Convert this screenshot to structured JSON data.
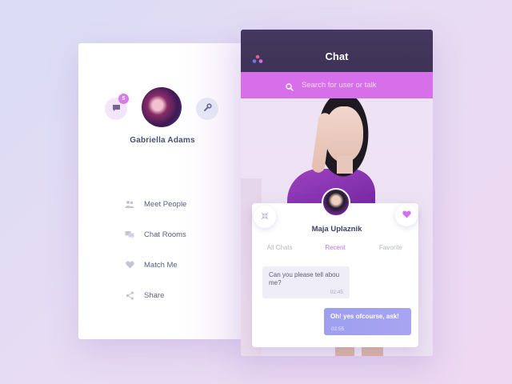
{
  "profile": {
    "name": "Gabriella Adams",
    "messages_badge": "5",
    "messages_icon": "chat-bubble-icon",
    "settings_icon": "wrench-icon"
  },
  "menu": {
    "items": [
      {
        "label": "Meet People",
        "icon": "people-icon"
      },
      {
        "label": "Chat Rooms",
        "icon": "chat-rooms-icon"
      },
      {
        "label": "Match Me",
        "icon": "heart-icon"
      },
      {
        "label": "Share",
        "icon": "share-icon"
      }
    ]
  },
  "chat": {
    "title": "Chat",
    "search_placeholder": "Search for user or talk",
    "contact_name": "Maja Uplaznik",
    "tabs": [
      {
        "label": "All Chats",
        "active": false
      },
      {
        "label": "Recent",
        "active": true
      },
      {
        "label": "Favorite",
        "active": false
      }
    ],
    "messages": [
      {
        "direction": "incoming",
        "text": "Can you please tell abou me?",
        "time": "02:45"
      },
      {
        "direction": "outgoing",
        "text": "Oh! yes ofcourse, ask!",
        "time": "02:55"
      }
    ]
  },
  "colors": {
    "accent": "#d76eea",
    "header": "#43375d",
    "outgoing_bubble": "#a1a2f0",
    "incoming_bubble": "#efedf8"
  }
}
